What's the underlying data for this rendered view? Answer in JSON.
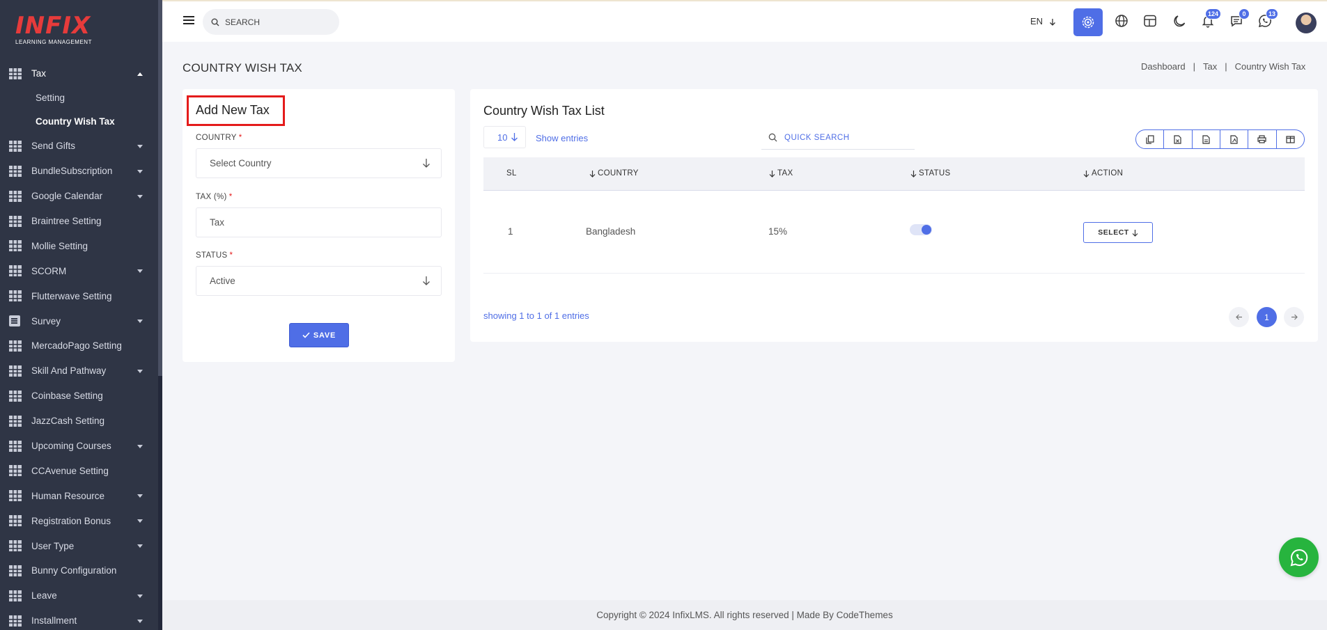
{
  "brand": {
    "logo_text": "INFIX",
    "logo_subtitle": "LEARNING MANAGEMENT"
  },
  "sidebar": {
    "items": [
      {
        "label": "Tax",
        "icon": "grid-icon",
        "has_caret": true,
        "expanded": true
      },
      {
        "label": "Send Gifts",
        "icon": "grid-icon",
        "has_caret": true
      },
      {
        "label": "BundleSubscription",
        "icon": "grid-icon",
        "has_caret": true
      },
      {
        "label": "Google Calendar",
        "icon": "grid-icon",
        "has_caret": true
      },
      {
        "label": "Braintree Setting",
        "icon": "grid-icon",
        "has_caret": false
      },
      {
        "label": "Mollie Setting",
        "icon": "grid-icon",
        "has_caret": false
      },
      {
        "label": "SCORM",
        "icon": "grid-icon",
        "has_caret": true
      },
      {
        "label": "Flutterwave Setting",
        "icon": "grid-icon",
        "has_caret": false
      },
      {
        "label": "Survey",
        "icon": "survey-icon",
        "has_caret": true
      },
      {
        "label": "MercadoPago Setting",
        "icon": "grid-icon",
        "has_caret": false
      },
      {
        "label": "Skill And Pathway",
        "icon": "grid-icon",
        "has_caret": true
      },
      {
        "label": "Coinbase Setting",
        "icon": "grid-icon",
        "has_caret": false
      },
      {
        "label": "JazzCash Setting",
        "icon": "grid-icon",
        "has_caret": false
      },
      {
        "label": "Upcoming Courses",
        "icon": "grid-icon",
        "has_caret": true
      },
      {
        "label": "CCAvenue Setting",
        "icon": "grid-icon",
        "has_caret": false
      },
      {
        "label": "Human Resource",
        "icon": "grid-icon",
        "has_caret": true
      },
      {
        "label": "Registration Bonus",
        "icon": "grid-icon",
        "has_caret": true
      },
      {
        "label": "User Type",
        "icon": "grid-icon",
        "has_caret": true
      },
      {
        "label": "Bunny Configuration",
        "icon": "grid-icon",
        "has_caret": false
      },
      {
        "label": "Leave",
        "icon": "grid-icon",
        "has_caret": true
      },
      {
        "label": "Installment",
        "icon": "grid-icon",
        "has_caret": true
      }
    ],
    "tax_subitems": [
      {
        "label": "Setting",
        "active": false
      },
      {
        "label": "Country Wish Tax",
        "active": true
      }
    ]
  },
  "header": {
    "search_placeholder": "SEARCH",
    "language": "EN",
    "notifications_count": "124",
    "messages_count": "0",
    "whatsapp_count": "13"
  },
  "page": {
    "title": "COUNTRY WISH TAX",
    "breadcrumb": [
      "Dashboard",
      "Tax",
      "Country Wish Tax"
    ]
  },
  "form": {
    "title": "Add New Tax",
    "country_label": "COUNTRY",
    "country_value": "Select Country",
    "tax_label": "TAX (%)",
    "tax_placeholder": "Tax",
    "status_label": "STATUS",
    "status_value": "Active",
    "required_mark": "*",
    "save_label": "SAVE"
  },
  "list": {
    "title": "Country Wish Tax List",
    "page_size": "10",
    "show_entries": "Show entries",
    "quick_search_placeholder": "QUICK SEARCH",
    "columns": [
      "SL",
      "COUNTRY",
      "TAX",
      "STATUS",
      "ACTION"
    ],
    "rows": [
      {
        "sl": "1",
        "country": "Bangladesh",
        "tax": "15%",
        "status_on": true,
        "action": "SELECT"
      }
    ],
    "showing": "showing 1 to 1 of 1 entries",
    "current_page": "1"
  },
  "footer": {
    "text": "Copyright © 2024 InfixLMS. All rights reserved | Made By CodeThemes"
  },
  "colors": {
    "sidebar_bg": "#2f3545",
    "accent": "#4f6ee6",
    "highlight_red": "#e41b1b",
    "whatsapp_green": "#27b43e"
  }
}
